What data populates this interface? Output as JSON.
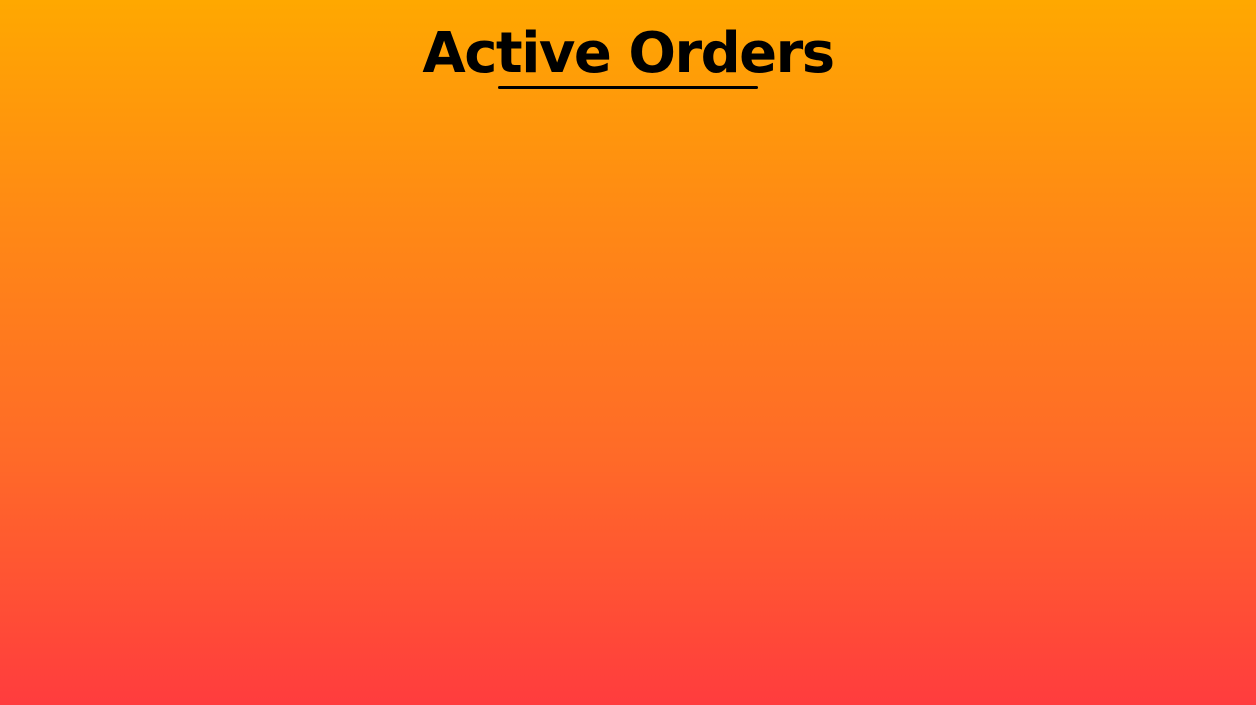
{
  "header": {
    "title": "Active Orders"
  },
  "orders": [],
  "colors": {
    "gradient_top": "#ffa800",
    "gradient_bottom": "#ff3c3e",
    "title_text": "#000000"
  }
}
